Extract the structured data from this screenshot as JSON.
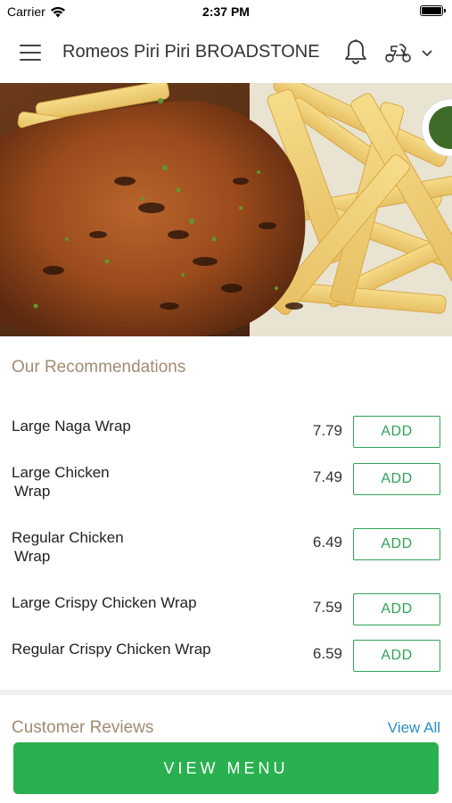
{
  "status_bar": {
    "carrier": "Carrier",
    "time": "2:37 PM"
  },
  "header": {
    "title": "Romeos Piri Piri BROADSTONE",
    "menu_icon": "hamburger-menu-icon",
    "notification_icon": "bell-icon",
    "delivery_icon": "scooter-icon",
    "dropdown_icon": "chevron-down-icon"
  },
  "hero": {
    "image": "grilled piri piri chicken with fries"
  },
  "recommendations": {
    "title": "Our Recommendations",
    "add_label": "ADD",
    "items": [
      {
        "name": "Large Naga Wrap",
        "price": "7.79"
      },
      {
        "name": "Large Chicken\n Wrap",
        "price": "7.49"
      },
      {
        "name": "Regular Chicken\n Wrap",
        "price": "6.49"
      },
      {
        "name": "Large Crispy Chicken Wrap",
        "price": "7.59"
      },
      {
        "name": "Regular Crispy Chicken Wrap",
        "price": "6.59"
      }
    ]
  },
  "reviews": {
    "title": "Customer Reviews",
    "view_all": "View All"
  },
  "footer": {
    "view_menu": "VIEW MENU"
  },
  "colors": {
    "accent_green": "#29b04f",
    "add_green": "#2fa454",
    "section_title": "#a08c72",
    "link_blue": "#2a8fc6"
  }
}
